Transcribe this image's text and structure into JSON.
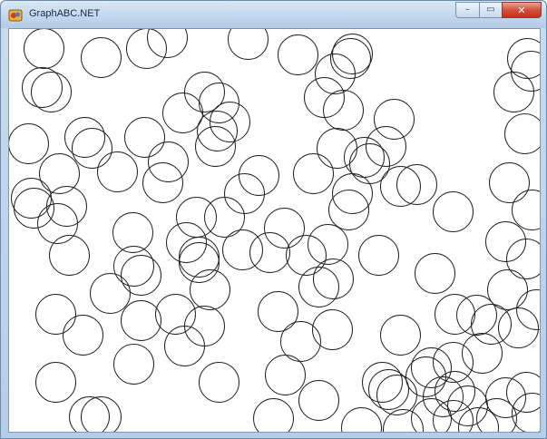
{
  "window": {
    "title": "GraphABC.NET",
    "icon": "graphabc-app-icon",
    "controls": {
      "minimize_label": "–",
      "maximize_label": "▭",
      "close_label": "✕"
    },
    "colors": {
      "titlebar": "#c3d7ee",
      "close_button": "#d24a35",
      "circle_stroke": "#222222",
      "canvas_background": "#ffffff"
    }
  },
  "canvas": {
    "shape": "circle",
    "stroke_color": "#222222",
    "fill": "none",
    "count": 131
  }
}
